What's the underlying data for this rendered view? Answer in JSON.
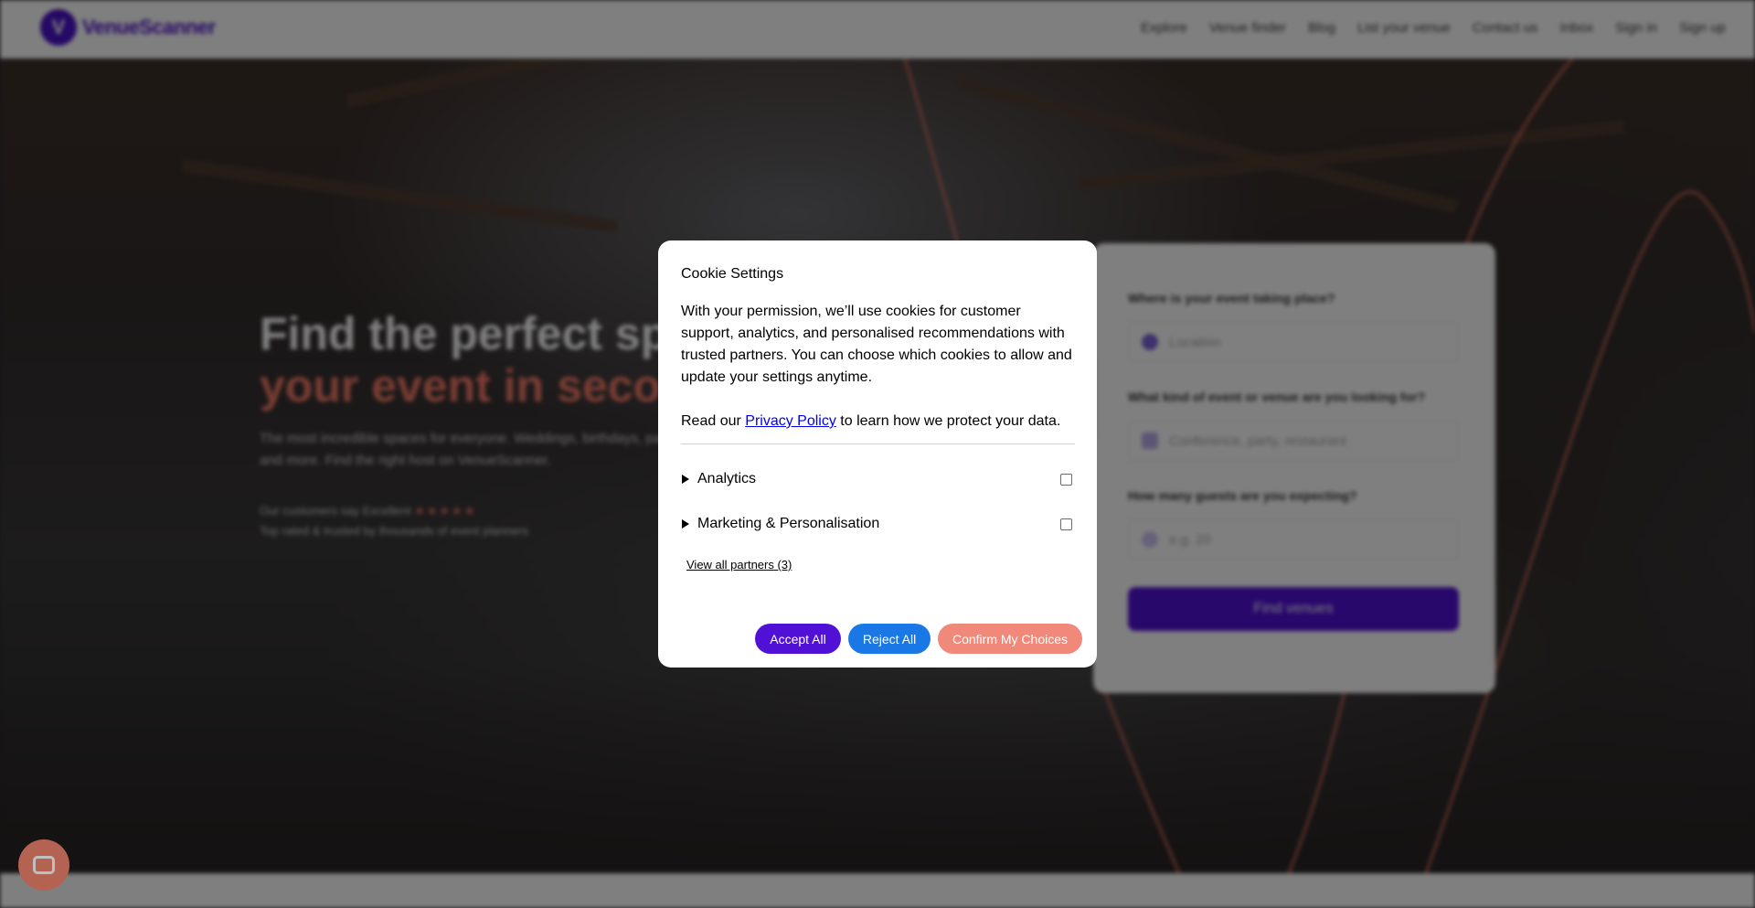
{
  "navbar": {
    "logo_mark": "V",
    "logo_text": "VenueScanner",
    "links": [
      "Explore",
      "Venue finder",
      "Blog",
      "List your venue",
      "Contact us",
      "Inbox",
      "Sign in",
      "Sign up"
    ]
  },
  "hero": {
    "title_line1": "Find the perfect space for",
    "title_line2": "your event in seconds",
    "subtitle": "The most incredible spaces for everyone. Weddings, birthdays, parties and more. Find the right host on VenueScanner.",
    "rating_text": "Our customers say Excellent",
    "stars": "★★★★★",
    "trust_text": "Top rated & trusted by thousands of event planners"
  },
  "search_card": {
    "q1_label": "Where is your event taking place?",
    "q1_placeholder": "Location",
    "q2_label": "What kind of event or venue are you looking for?",
    "q2_placeholder": "Conference, party, restaurant",
    "q3_label": "How many guests are you expecting?",
    "q3_placeholder": "e.g. 20",
    "submit_label": "Find venues"
  },
  "cookie_modal": {
    "title": "Cookie Settings",
    "body": "With your permission, we’ll use cookies for customer support, analytics, and personalised recommendations with trusted partners. You can choose which cookies to allow and update your settings anytime.",
    "policy_prefix": "Read our ",
    "policy_link": "Privacy Policy",
    "policy_suffix": " to learn how we protect your data.",
    "categories": [
      {
        "label": "Analytics",
        "checked": false
      },
      {
        "label": "Marketing & Personalisation",
        "checked": false
      }
    ],
    "partners_link": "View all partners (3)",
    "buttons": {
      "accept": "Accept All",
      "reject": "Reject All",
      "confirm": "Confirm My Choices"
    }
  },
  "colors": {
    "brand_purple": "#5010d6",
    "accent_coral": "#f47a66",
    "reject_blue": "#1a78e6",
    "confirm_coral": "#f0897a"
  },
  "chat_widget": {
    "icon": "chat-bubble-icon"
  }
}
